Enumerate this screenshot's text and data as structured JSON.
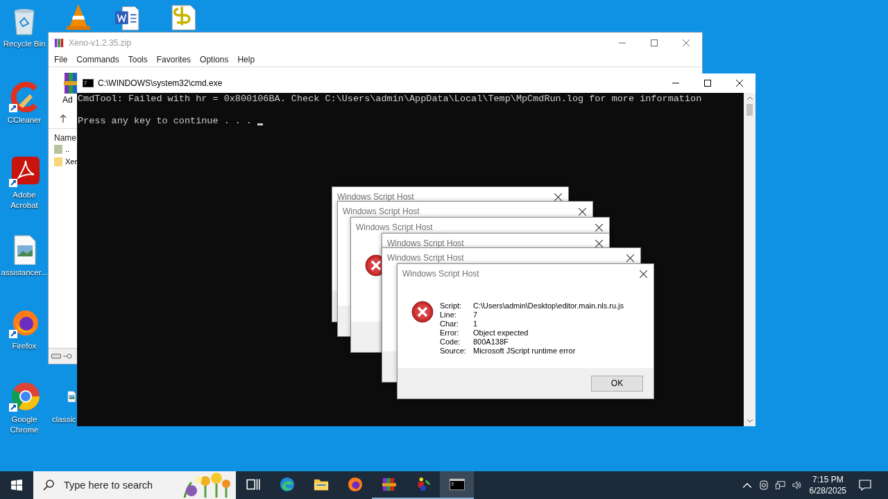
{
  "desktop_icons": [
    {
      "kind": "bin",
      "label": "Recycle Bin"
    },
    {
      "kind": "cleaner",
      "label": "CCleaner"
    },
    {
      "kind": "pdf",
      "label": "Adobe Acrobat"
    },
    {
      "kind": "image",
      "label": "assistancer..."
    },
    {
      "kind": "fox",
      "label": "Firefox"
    },
    {
      "kind": "round",
      "label": "Google Chrome"
    },
    {
      "kind": "image",
      "label": "classic"
    }
  ],
  "archive_window": {
    "title": "Xeno-v1.2.35.zip",
    "menu": [
      "File",
      "Commands",
      "Tools",
      "Favorites",
      "Options",
      "Help"
    ],
    "toolbar_label": "Ad",
    "column": "Name",
    "rows": [
      {
        "kind": "parent",
        "name": ".."
      },
      {
        "kind": "folder",
        "name": "Xen"
      }
    ]
  },
  "console_window": {
    "title": "C:\\WINDOWS\\system32\\cmd.exe",
    "lines": [
      "CmdTool: Failed with hr = 0x800106BA. Check C:\\Users\\admin\\AppData\\Local\\Temp\\MpCmdRun.log for more information",
      "Press any key to continue . . ."
    ]
  },
  "dialogs": [
    {
      "title": "Windows Script Host"
    },
    {
      "title": "Windows Script Host"
    },
    {
      "title": "Windows Script Host",
      "kind": "error"
    },
    {
      "title": "Windows Script Host"
    },
    {
      "title": "Windows Script Host"
    },
    {
      "title": "Windows Script Host",
      "kind": "error",
      "fields": [
        {
          "label": "Script:",
          "value": "C:\\Users\\admin\\Desktop\\editor.main.nls.ru.js"
        },
        {
          "label": "Line:",
          "value": "7"
        },
        {
          "label": "Char:",
          "value": "1"
        },
        {
          "label": "Error:",
          "value": "Object expected"
        },
        {
          "label": "Code:",
          "value": "800A138F"
        },
        {
          "label": "Source:",
          "value": "Microsoft JScript runtime error"
        }
      ],
      "button": "OK"
    }
  ],
  "taskbar": {
    "search_placeholder": "Type here to search",
    "apps": [
      {
        "kind": "taskview",
        "running": false,
        "active": false
      },
      {
        "kind": "edge",
        "running": false,
        "active": false
      },
      {
        "kind": "folder",
        "running": false,
        "active": false
      },
      {
        "kind": "fox",
        "running": false,
        "active": false
      },
      {
        "kind": "archive",
        "running": true,
        "active": false
      },
      {
        "kind": "tool",
        "running": true,
        "active": false
      },
      {
        "kind": "console",
        "running": true,
        "active": true
      }
    ],
    "time": "7:15 PM",
    "date": "6/28/2025"
  }
}
